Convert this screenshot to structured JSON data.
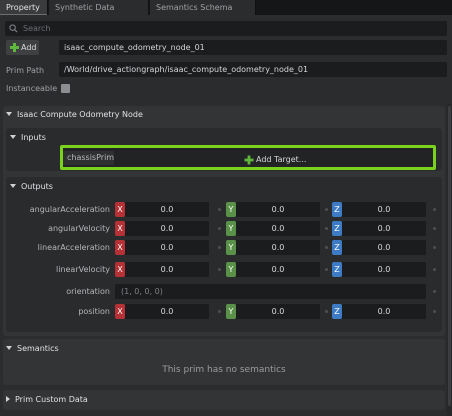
{
  "tabs": [
    {
      "label": "Property",
      "active": true
    },
    {
      "label": "Synthetic Data Recorder",
      "active": false
    },
    {
      "label": "Semantics Schema Editor",
      "active": false
    }
  ],
  "search": {
    "placeholder": "Search"
  },
  "add_button": {
    "label": "Add"
  },
  "prim": {
    "name": "isaac_compute_odometry_node_01",
    "path_label": "Prim Path",
    "path": "/World/drive_actiongraph/isaac_compute_odometry_node_01",
    "instanceable_label": "Instanceable"
  },
  "node_section": {
    "title": "Isaac Compute Odometry Node",
    "inputs": {
      "title": "Inputs",
      "chassis_label": "chassisPrim",
      "add_target_label": "Add Target..."
    },
    "outputs": {
      "title": "Outputs",
      "axis_labels": {
        "x": "X",
        "y": "Y",
        "z": "Z"
      },
      "rows": [
        {
          "label": "angularAcceleration",
          "x": "0.0",
          "y": "0.0",
          "z": "0.0"
        },
        {
          "label": "angularVelocity",
          "x": "0.0",
          "y": "0.0",
          "z": "0.0"
        },
        {
          "label": "linearAcceleration",
          "x": "0.0",
          "y": "0.0",
          "z": "0.0"
        },
        {
          "label": "linearVelocity",
          "x": "0.0",
          "y": "0.0",
          "z": "0.0"
        }
      ],
      "orientation": {
        "label": "orientation",
        "value": "(1, 0, 0, 0)"
      },
      "position": {
        "label": "position",
        "x": "0.0",
        "y": "0.0",
        "z": "0.0"
      }
    }
  },
  "semantics": {
    "title": "Semantics",
    "message": "This prim has no semantics"
  },
  "prim_custom_data": {
    "title": "Prim Custom Data"
  },
  "colors": {
    "highlight": "#7ad21c",
    "x_axis": "#b53135",
    "y_axis": "#5a9148",
    "z_axis": "#3d7bc4",
    "add_icon": "#5fb83b"
  },
  "icons": [
    "search-icon",
    "plus-icon",
    "collapse-triangle-icon",
    "expand-triangle-icon"
  ]
}
